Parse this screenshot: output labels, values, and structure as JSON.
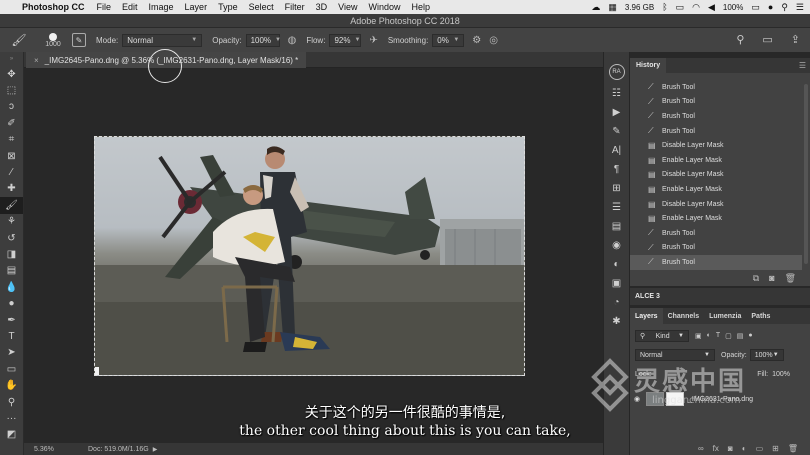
{
  "menubar": {
    "app_name": "Photoshop CC",
    "items": [
      "File",
      "Edit",
      "Image",
      "Layer",
      "Type",
      "Select",
      "Filter",
      "3D",
      "View",
      "Window",
      "Help"
    ],
    "memory": "3.96 GB",
    "battery": "100%"
  },
  "titlebar": {
    "title": "Adobe Photoshop CC 2018"
  },
  "options": {
    "brush_size": "1000",
    "mode_label": "Mode:",
    "mode_value": "Normal",
    "opacity_label": "Opacity:",
    "opacity_value": "100%",
    "flow_label": "Flow:",
    "flow_value": "92%",
    "smoothing_label": "Smoothing:",
    "smoothing_value": "0%"
  },
  "document": {
    "tab_title": "_IMG2645-Pano.dng @ 5.36% (_IMG2631-Pano.dng, Layer Mask/16) *"
  },
  "statusbar": {
    "zoom": "5.36%",
    "doc_size": "Doc: 519.0M/1.16G"
  },
  "dock": {
    "avatar": "RA"
  },
  "history": {
    "tab": "History",
    "items": [
      "Brush Tool",
      "Brush Tool",
      "Brush Tool",
      "Brush Tool",
      "Disable Layer Mask",
      "Enable Layer Mask",
      "Disable Layer Mask",
      "Enable Layer Mask",
      "Disable Layer Mask",
      "Enable Layer Mask",
      "Brush Tool",
      "Brush Tool",
      "Brush Tool"
    ],
    "active_index": 12
  },
  "alce": {
    "title": "ALCE 3"
  },
  "layers": {
    "tabs": [
      "Layers",
      "Channels",
      "Lumenzia",
      "Paths"
    ],
    "filter_kind": "Kind",
    "blend_mode": "Normal",
    "opacity_label": "Opacity:",
    "opacity_value": "100%",
    "lock_label": "Lock:",
    "fill_label": "Fill:",
    "fill_value": "100%",
    "layer_name": "_IMG2631-Pano.dng"
  },
  "subtitles": {
    "cn": "关于这个的另一件很酷的事情是,",
    "en": "the other cool thing about this is you can take,"
  },
  "watermark": {
    "cn": "灵感中国",
    "en": "lingganchina.com"
  }
}
